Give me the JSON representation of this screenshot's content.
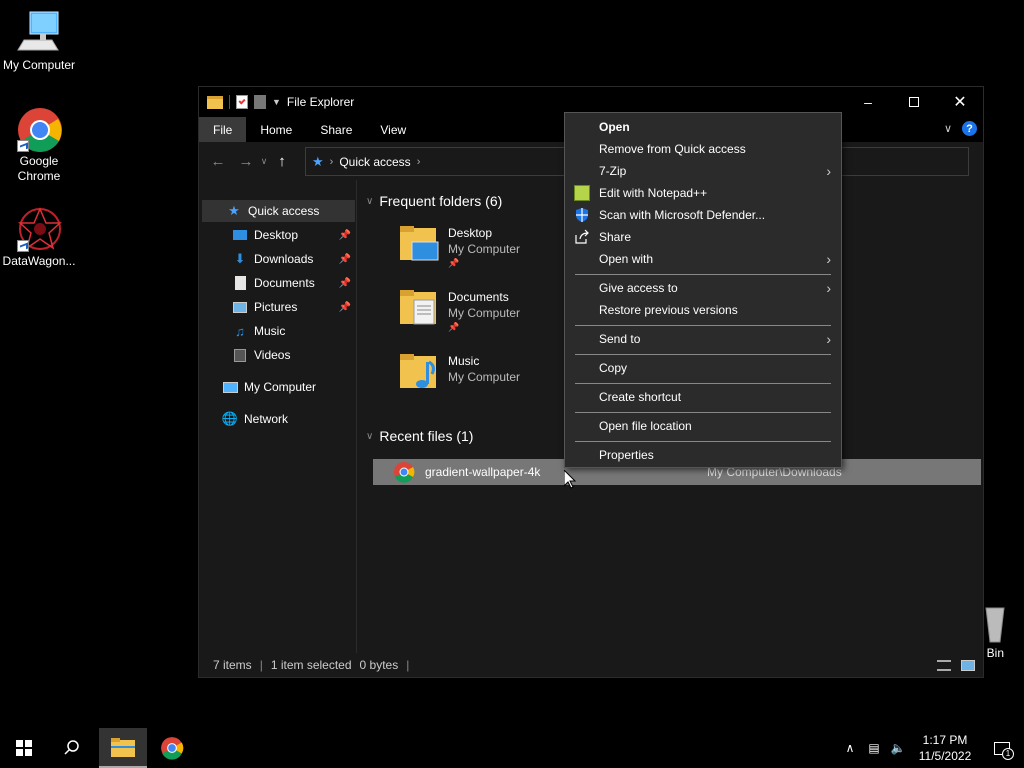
{
  "desktop": {
    "icons": [
      {
        "label": "My Computer"
      },
      {
        "label": "Google Chrome"
      },
      {
        "label": "DataWagon..."
      },
      {
        "label": "e Bin"
      }
    ]
  },
  "window": {
    "title": "File Explorer",
    "ribbon_tabs": [
      "File",
      "Home",
      "Share",
      "View"
    ],
    "help": "?",
    "address": {
      "path": [
        "Quick access"
      ]
    },
    "sidebar": {
      "items": [
        {
          "label": "Quick access",
          "icon": "star-icon"
        },
        {
          "label": "Desktop",
          "icon": "desktop-icon",
          "pinned": true
        },
        {
          "label": "Downloads",
          "icon": "download-icon",
          "pinned": true
        },
        {
          "label": "Documents",
          "icon": "document-icon",
          "pinned": true
        },
        {
          "label": "Pictures",
          "icon": "picture-icon",
          "pinned": true
        },
        {
          "label": "Music",
          "icon": "music-icon"
        },
        {
          "label": "Videos",
          "icon": "video-icon"
        },
        {
          "label": "My Computer",
          "icon": "computer-icon"
        },
        {
          "label": "Network",
          "icon": "network-icon"
        }
      ]
    },
    "frequent": {
      "header": "Frequent folders (6)",
      "folders": [
        {
          "name": "Desktop",
          "location": "My Computer"
        },
        {
          "name": "Documents",
          "location": "My Computer"
        },
        {
          "name": "Music",
          "location": "My Computer"
        }
      ]
    },
    "recent": {
      "header": "Recent files (1)",
      "files": [
        {
          "name": "gradient-wallpaper-4k",
          "location": "My Computer\\Downloads"
        }
      ]
    },
    "status": {
      "items": "7 items",
      "selected": "1 item selected",
      "size": "0 bytes"
    }
  },
  "context_menu": {
    "items": [
      {
        "label": "Open"
      },
      {
        "label": "Remove from Quick access"
      },
      {
        "label": "7-Zip"
      },
      {
        "label": "Edit with Notepad++"
      },
      {
        "label": "Scan with Microsoft Defender..."
      },
      {
        "label": "Share"
      },
      {
        "label": "Open with"
      },
      {
        "label": "Give access to"
      },
      {
        "label": "Restore previous versions"
      },
      {
        "label": "Send to"
      },
      {
        "label": "Copy"
      },
      {
        "label": "Create shortcut"
      },
      {
        "label": "Open file location"
      },
      {
        "label": "Properties"
      }
    ]
  },
  "taskbar": {
    "time": "1:17 PM",
    "date": "11/5/2022",
    "notifications": "1"
  },
  "colors": {
    "accent": "#1a73e8",
    "folder": "#f2c24e"
  }
}
